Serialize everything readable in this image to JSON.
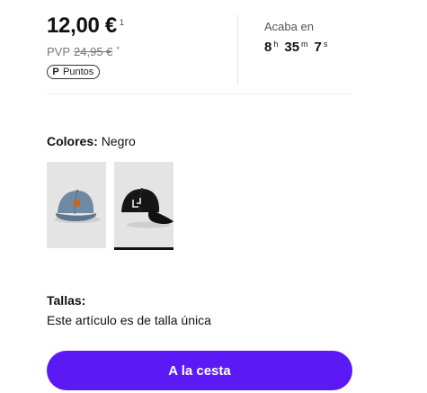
{
  "price": {
    "current": "12,00 €",
    "current_footnote": "1",
    "pvp_label": "PVP",
    "pvp_value": "24,95 €",
    "pvp_footnote": "*",
    "points_label": "Puntos",
    "points_icon": "P"
  },
  "countdown": {
    "label": "Acaba en",
    "hours": "8",
    "hours_unit": "h",
    "minutes": "35",
    "minutes_unit": "m",
    "seconds": "7",
    "seconds_unit": "s"
  },
  "colors": {
    "heading_label": "Colores:",
    "selected_value": "Negro",
    "swatches": [
      {
        "name": "denim-cap",
        "icon": "cap-icon",
        "selected": false
      },
      {
        "name": "black-cap",
        "icon": "cap-icon",
        "selected": true
      }
    ]
  },
  "sizes": {
    "heading": "Tallas:",
    "text": "Este artículo es de talla única"
  },
  "cart_button": {
    "label": "A la cesta",
    "color": "#5b1af5"
  }
}
